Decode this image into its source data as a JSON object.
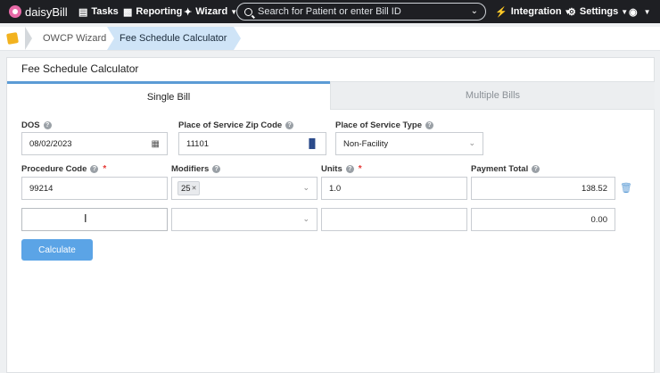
{
  "nav": {
    "logo_text": "daisyBill",
    "tasks": "Tasks",
    "reporting": "Reporting",
    "wizard": "Wizard",
    "search_placeholder": "Search for Patient or enter Bill ID",
    "integration": "Integration",
    "settings": "Settings"
  },
  "breadcrumb": {
    "items": [
      "OWCP Wizard",
      "Fee Schedule Calculator"
    ]
  },
  "page": {
    "title": "Fee Schedule Calculator",
    "tabs": [
      "Single Bill",
      "Multiple Bills"
    ]
  },
  "form": {
    "dos_label": "DOS",
    "dos_value": "08/02/2023",
    "zip_label": "Place of Service Zip Code",
    "zip_value": "11101",
    "pos_type_label": "Place of Service Type",
    "pos_type_value": "Non-Facility",
    "procedure_label": "Procedure Code",
    "modifiers_label": "Modifiers",
    "units_label": "Units",
    "payment_label": "Payment Total",
    "required_mark": "*",
    "rows": [
      {
        "procedure": "99214",
        "modifier": "25",
        "units": "1.0",
        "payment": "138.52"
      },
      {
        "procedure": "",
        "modifier": "",
        "units": "",
        "payment": "0.00"
      }
    ],
    "calculate_label": "Calculate"
  },
  "colors": {
    "accent": "#5ba4e6",
    "nav_bg": "#1e1f23",
    "active_crumb": "#cfe4f7",
    "required": "#e53935"
  }
}
